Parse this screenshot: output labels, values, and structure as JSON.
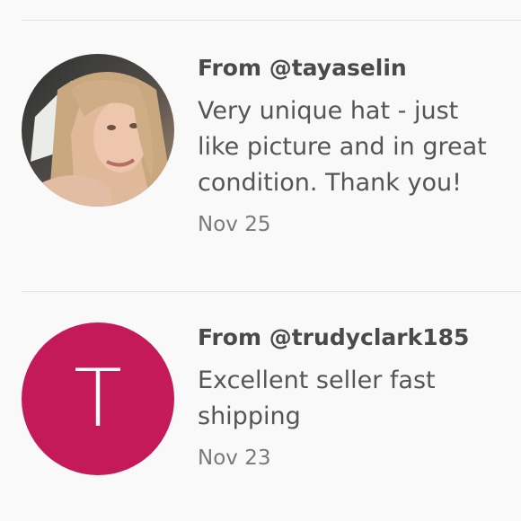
{
  "reviews": [
    {
      "from": "From @tayaselin",
      "text": "Very unique hat - just like picture and in great condition. Thank you!",
      "date": "Nov 25",
      "avatar": {
        "type": "photo"
      }
    },
    {
      "from": "From @trudyclark185",
      "text": "Excellent seller fast shipping",
      "date": "Nov 23",
      "avatar": {
        "type": "initial",
        "letter": "T",
        "color": "#c41a5a"
      }
    }
  ]
}
